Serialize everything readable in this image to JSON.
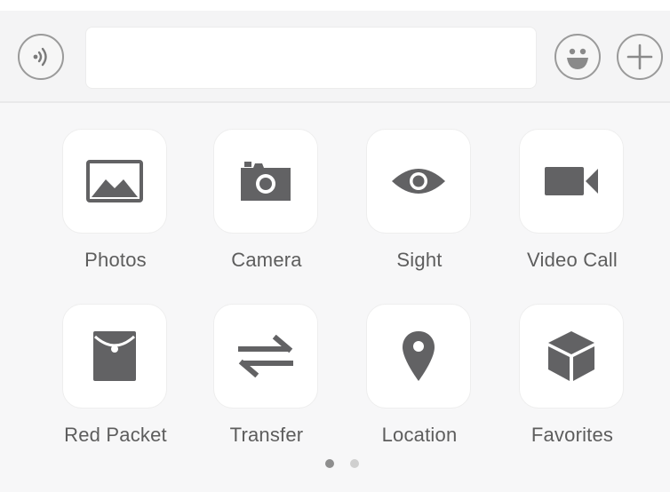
{
  "input_bar": {
    "voice_button": "voice-wave-icon",
    "text_value": "",
    "emoji_button": "smiley-face-icon",
    "plus_button": "plus-icon"
  },
  "panel": {
    "items": [
      {
        "label": "Photos",
        "icon": "photo-icon"
      },
      {
        "label": "Camera",
        "icon": "camera-icon"
      },
      {
        "label": "Sight",
        "icon": "eye-icon"
      },
      {
        "label": "Video Call",
        "icon": "video-camera-icon"
      },
      {
        "label": "Red Packet",
        "icon": "red-packet-icon"
      },
      {
        "label": "Transfer",
        "icon": "transfer-arrows-icon"
      },
      {
        "label": "Location",
        "icon": "location-pin-icon"
      },
      {
        "label": "Favorites",
        "icon": "cube-icon"
      }
    ],
    "pager": {
      "pages": 2,
      "current": 1
    }
  },
  "colors": {
    "icon": "#626264",
    "tile_bg": "#ffffff",
    "panel_bg": "#f7f7f8",
    "label": "#5d5d5d"
  }
}
